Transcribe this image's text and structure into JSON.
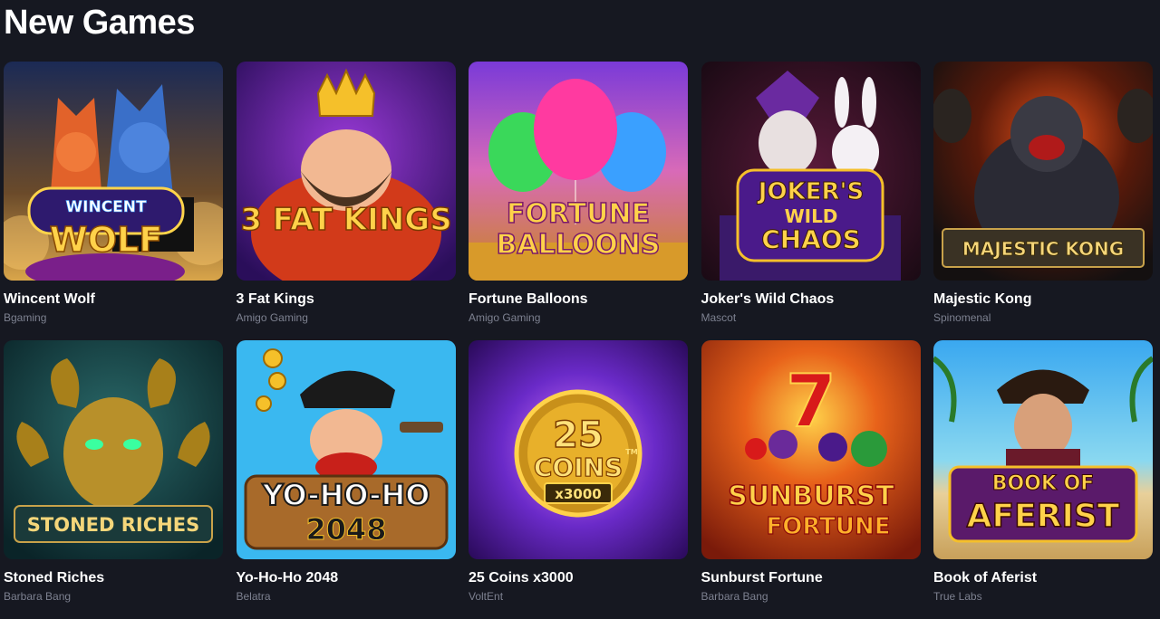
{
  "section": {
    "title": "New Games"
  },
  "games": [
    {
      "name": "Wincent Wolf",
      "provider": "Bgaming",
      "logo_line1": "WINCENT",
      "logo_line2": "WOLF"
    },
    {
      "name": "3 Fat Kings",
      "provider": "Amigo Gaming",
      "logo_line1": "3 FAT KINGS",
      "logo_line2": ""
    },
    {
      "name": "Fortune Balloons",
      "provider": "Amigo Gaming",
      "logo_line1": "FORTUNE",
      "logo_line2": "BALLOONS"
    },
    {
      "name": "Joker's Wild Chaos",
      "provider": "Mascot",
      "logo_line1": "JOKER'S",
      "logo_line2": "WILD",
      "logo_line3": "CHAOS"
    },
    {
      "name": "Majestic Kong",
      "provider": "Spinomenal",
      "logo_line1": "MAJESTIC KONG",
      "logo_line2": ""
    },
    {
      "name": "Stoned Riches",
      "provider": "Barbara Bang",
      "logo_line1": "STONED RICHES",
      "logo_line2": ""
    },
    {
      "name": "Yo-Ho-Ho 2048",
      "provider": "Belatra",
      "logo_line1": "YO-HO-HO",
      "logo_line2": "2048"
    },
    {
      "name": "25 Coins x3000",
      "provider": "VoltEnt",
      "logo_line1": "25",
      "logo_line2": "COINS",
      "logo_line3": "x3000",
      "logo_tm": "TM"
    },
    {
      "name": "Sunburst Fortune",
      "provider": "Barbara Bang",
      "logo_line1": "SUNBURST",
      "logo_line2": "FORTUNE"
    },
    {
      "name": "Book of Aferist",
      "provider": "True Labs",
      "logo_line1": "BOOK OF",
      "logo_line2": "AFERIST"
    }
  ],
  "colors": {
    "background": "#161821",
    "title": "#ffffff",
    "provider": "#7d8190"
  }
}
